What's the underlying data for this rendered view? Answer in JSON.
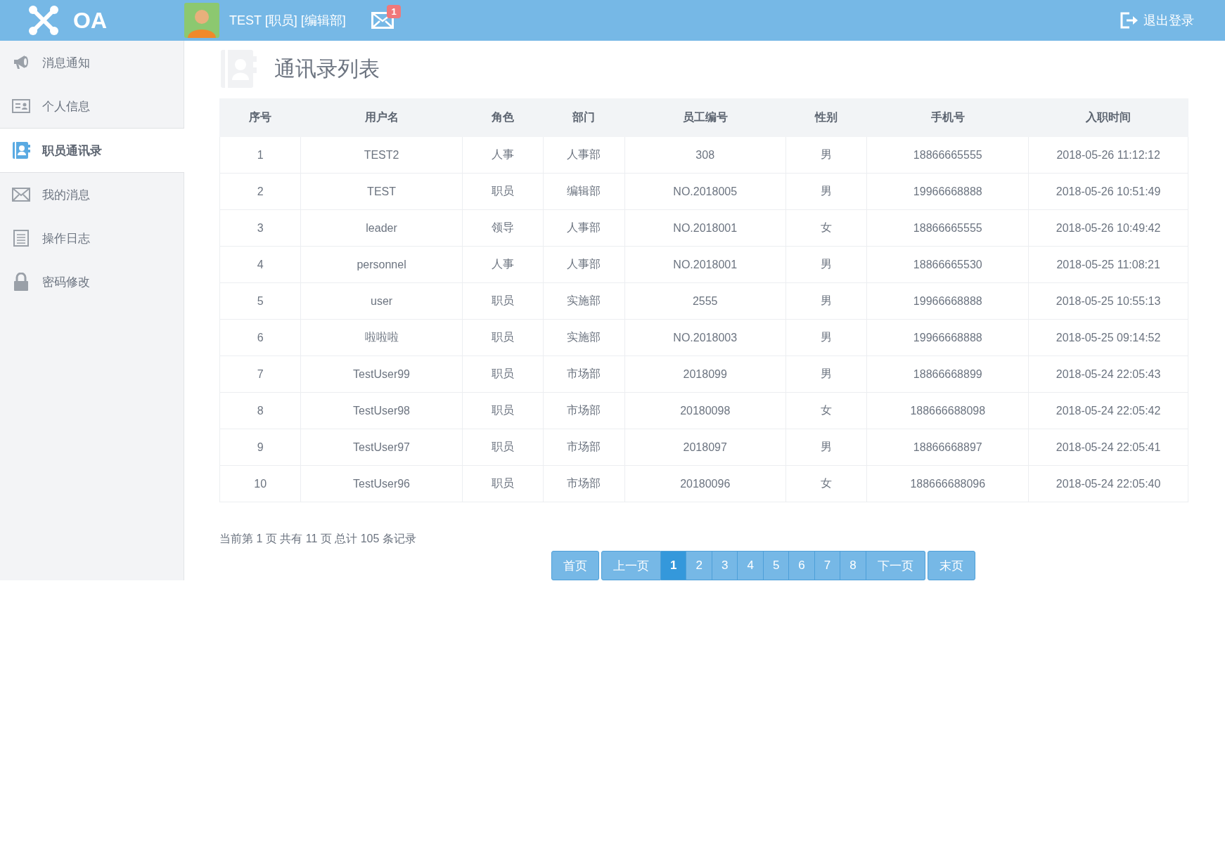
{
  "header": {
    "logo": "OA",
    "user": "TEST [职员] [编辑部]",
    "mail_badge": "1",
    "logout": "退出登录"
  },
  "sidebar": {
    "items": [
      {
        "label": "消息通知",
        "selected": false
      },
      {
        "label": "个人信息",
        "selected": false
      },
      {
        "label": "职员通讯录",
        "selected": true
      },
      {
        "label": "我的消息",
        "selected": false
      },
      {
        "label": "操作日志",
        "selected": false
      },
      {
        "label": "密码修改",
        "selected": false
      }
    ]
  },
  "page_title": "通讯录列表",
  "table": {
    "columns": [
      "序号",
      "用户名",
      "角色",
      "部门",
      "员工编号",
      "性别",
      "手机号",
      "入职时间"
    ],
    "rows": [
      [
        "1",
        "TEST2",
        "人事",
        "人事部",
        "308",
        "男",
        "18866665555",
        "2018-05-26 11:12:12"
      ],
      [
        "2",
        "TEST",
        "职员",
        "编辑部",
        "NO.2018005",
        "男",
        "19966668888",
        "2018-05-26 10:51:49"
      ],
      [
        "3",
        "leader",
        "领导",
        "人事部",
        "NO.2018001",
        "女",
        "18866665555",
        "2018-05-26 10:49:42"
      ],
      [
        "4",
        "personnel",
        "人事",
        "人事部",
        "NO.2018001",
        "男",
        "18866665530",
        "2018-05-25 11:08:21"
      ],
      [
        "5",
        "user",
        "职员",
        "实施部",
        "2555",
        "男",
        "19966668888",
        "2018-05-25 10:55:13"
      ],
      [
        "6",
        "啦啦啦",
        "职员",
        "实施部",
        "NO.2018003",
        "男",
        "19966668888",
        "2018-05-25 09:14:52"
      ],
      [
        "7",
        "TestUser99",
        "职员",
        "市场部",
        "2018099",
        "男",
        "18866668899",
        "2018-05-24 22:05:43"
      ],
      [
        "8",
        "TestUser98",
        "职员",
        "市场部",
        "20180098",
        "女",
        "188666688098",
        "2018-05-24 22:05:42"
      ],
      [
        "9",
        "TestUser97",
        "职员",
        "市场部",
        "2018097",
        "男",
        "18866668897",
        "2018-05-24 22:05:41"
      ],
      [
        "10",
        "TestUser96",
        "职员",
        "市场部",
        "20180096",
        "女",
        "188666688096",
        "2018-05-24 22:05:40"
      ]
    ]
  },
  "pagination": {
    "summary": "当前第 1 页 共有 11 页 总计 105 条记录",
    "buttons": [
      {
        "label": "首页",
        "kind": "first",
        "selected": false
      },
      {
        "label": "上一页",
        "kind": "prev",
        "selected": false
      },
      {
        "label": "1",
        "kind": "page",
        "selected": true
      },
      {
        "label": "2",
        "kind": "page",
        "selected": false
      },
      {
        "label": "3",
        "kind": "page",
        "selected": false
      },
      {
        "label": "4",
        "kind": "page",
        "selected": false
      },
      {
        "label": "5",
        "kind": "page",
        "selected": false
      },
      {
        "label": "6",
        "kind": "page",
        "selected": false
      },
      {
        "label": "7",
        "kind": "page",
        "selected": false
      },
      {
        "label": "8",
        "kind": "page",
        "selected": false
      },
      {
        "label": "下一页",
        "kind": "next",
        "selected": false
      },
      {
        "label": "末页",
        "kind": "last",
        "selected": false
      }
    ]
  }
}
